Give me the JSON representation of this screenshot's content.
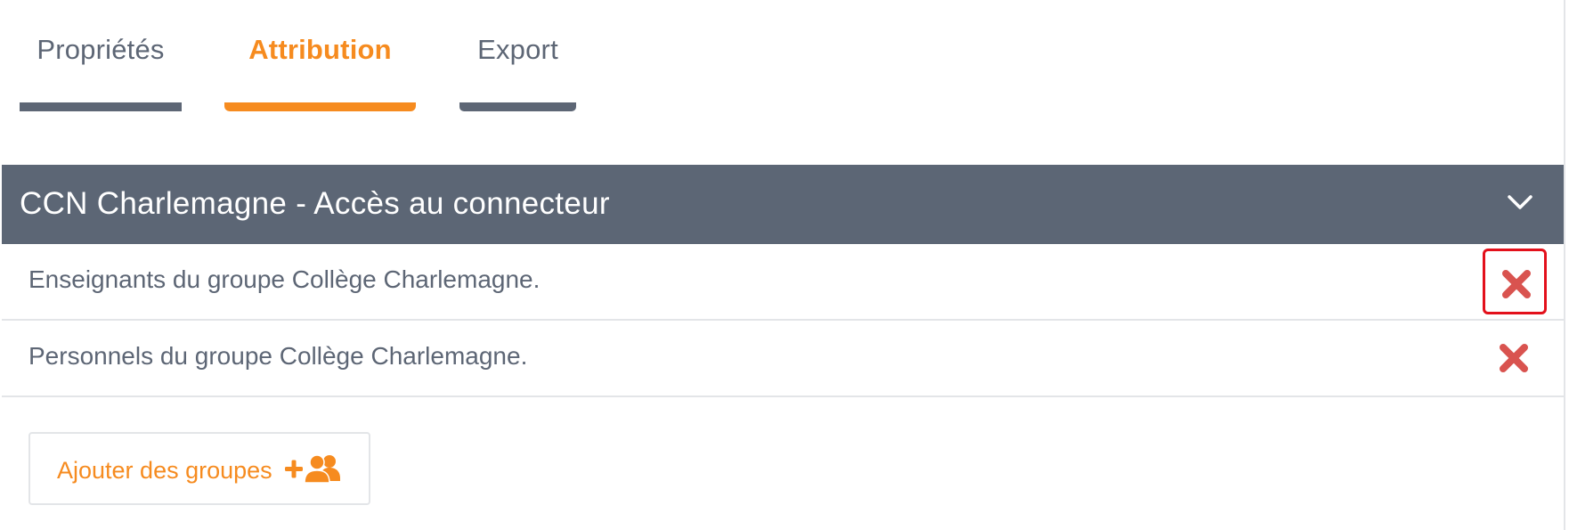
{
  "tabs": [
    {
      "label": "Propriétés",
      "active": false
    },
    {
      "label": "Attribution",
      "active": true
    },
    {
      "label": "Export",
      "active": false
    }
  ],
  "section": {
    "title": "CCN Charlemagne - Accès au connecteur",
    "toggle_icon": "chevron-down-icon"
  },
  "groups": [
    {
      "label": "Enseignants du groupe Collège Charlemagne.",
      "remove_icon": "close-icon",
      "highlighted": true
    },
    {
      "label": "Personnels du groupe Collège Charlemagne.",
      "remove_icon": "close-icon",
      "highlighted": false
    }
  ],
  "add_button": {
    "label": "Ajouter des groupes",
    "icon": "add-users-icon"
  },
  "colors": {
    "accent": "#f68b1f",
    "header_bg": "#5c6675",
    "text": "#5d6675",
    "remove": "#d9534f",
    "highlight": "#e3101b"
  }
}
